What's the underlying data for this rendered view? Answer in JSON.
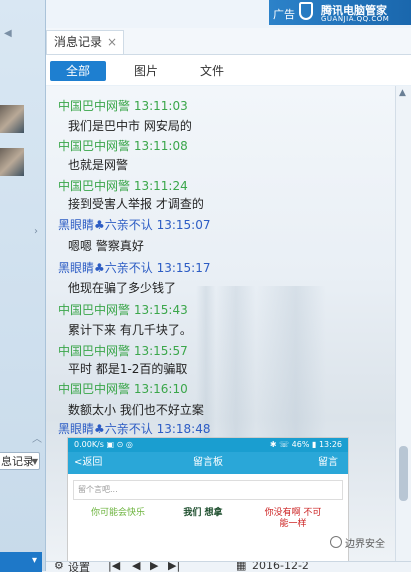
{
  "ad": {
    "label": "广告",
    "brand": "腾讯电脑管家",
    "brand_sub": "GUANJIA.QQ.COM"
  },
  "tab": {
    "title": "消息记录",
    "close": "×"
  },
  "filters": [
    "全部",
    "图片",
    "文件"
  ],
  "left_panel": {
    "select_label": "息记录"
  },
  "messages": [
    {
      "sender": "中国巴中网警",
      "time": "13:11:03",
      "text": "我们是巴中市 网安局的",
      "color": "green"
    },
    {
      "sender": "中国巴中网警",
      "time": "13:11:08",
      "text": "也就是网警",
      "color": "green"
    },
    {
      "sender": "中国巴中网警",
      "time": "13:11:24",
      "text": "接到受害人举报 才调查的",
      "color": "green"
    },
    {
      "sender": "黑眼睛♣六亲不认",
      "time": "13:15:07",
      "text": "嗯嗯  警察真好",
      "color": "blue"
    },
    {
      "sender": "黑眼睛♣六亲不认",
      "time": "13:15:17",
      "text": "他现在骗了多少钱了",
      "color": "blue"
    },
    {
      "sender": "中国巴中网警",
      "time": "13:15:43",
      "text": "累计下来 有几千块了。",
      "color": "green"
    },
    {
      "sender": "中国巴中网警",
      "time": "13:15:57",
      "text": "平时 都是1-2百的骗取",
      "color": "green"
    },
    {
      "sender": "中国巴中网警",
      "time": "13:16:10",
      "text": "数额太小 我们也不好立案",
      "color": "green"
    },
    {
      "sender": "黑眼睛♣六亲不认",
      "time": "13:18:48",
      "text": "",
      "color": "blue"
    }
  ],
  "phone": {
    "status_left": "0.00K/s ▣ ⊙ ◎",
    "status_right": "✱ ☏ 46% ▮ 13:26",
    "back": "<返回",
    "title": "留言板",
    "action": "留言",
    "input_placeholder": "留个言吧...",
    "stickers": [
      "你可能会快乐",
      "我们 想拿",
      "你没有啊 不可能一样"
    ]
  },
  "bottom_bar": {
    "settings": "设置",
    "date": "2016-12-2"
  },
  "watermark": "边界安全"
}
